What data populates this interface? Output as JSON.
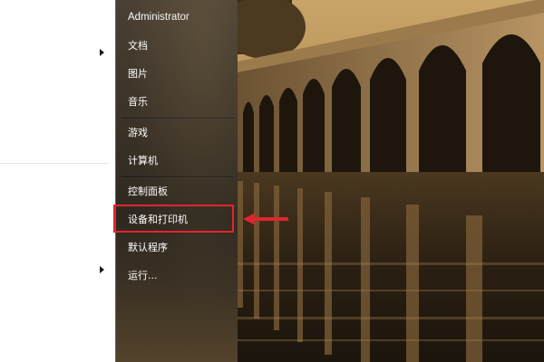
{
  "start_menu": {
    "user_name": "Administrator",
    "items": [
      {
        "label": "文档"
      },
      {
        "label": "图片"
      },
      {
        "label": "音乐"
      },
      {
        "label": "游戏"
      },
      {
        "label": "计算机"
      },
      {
        "label": "控制面板"
      },
      {
        "label": "设备和打印机"
      },
      {
        "label": "默认程序"
      },
      {
        "label": "运行..."
      }
    ],
    "highlighted_item": "设备和打印机"
  },
  "annotation": {
    "box_color": "#e0262e",
    "arrow_color": "#e0262e"
  },
  "background": {
    "subject": "seventeen-arch bridge photo (sepia)"
  },
  "icons": [
    "submenu-arrow-icon",
    "pointer-arrow-icon"
  ]
}
